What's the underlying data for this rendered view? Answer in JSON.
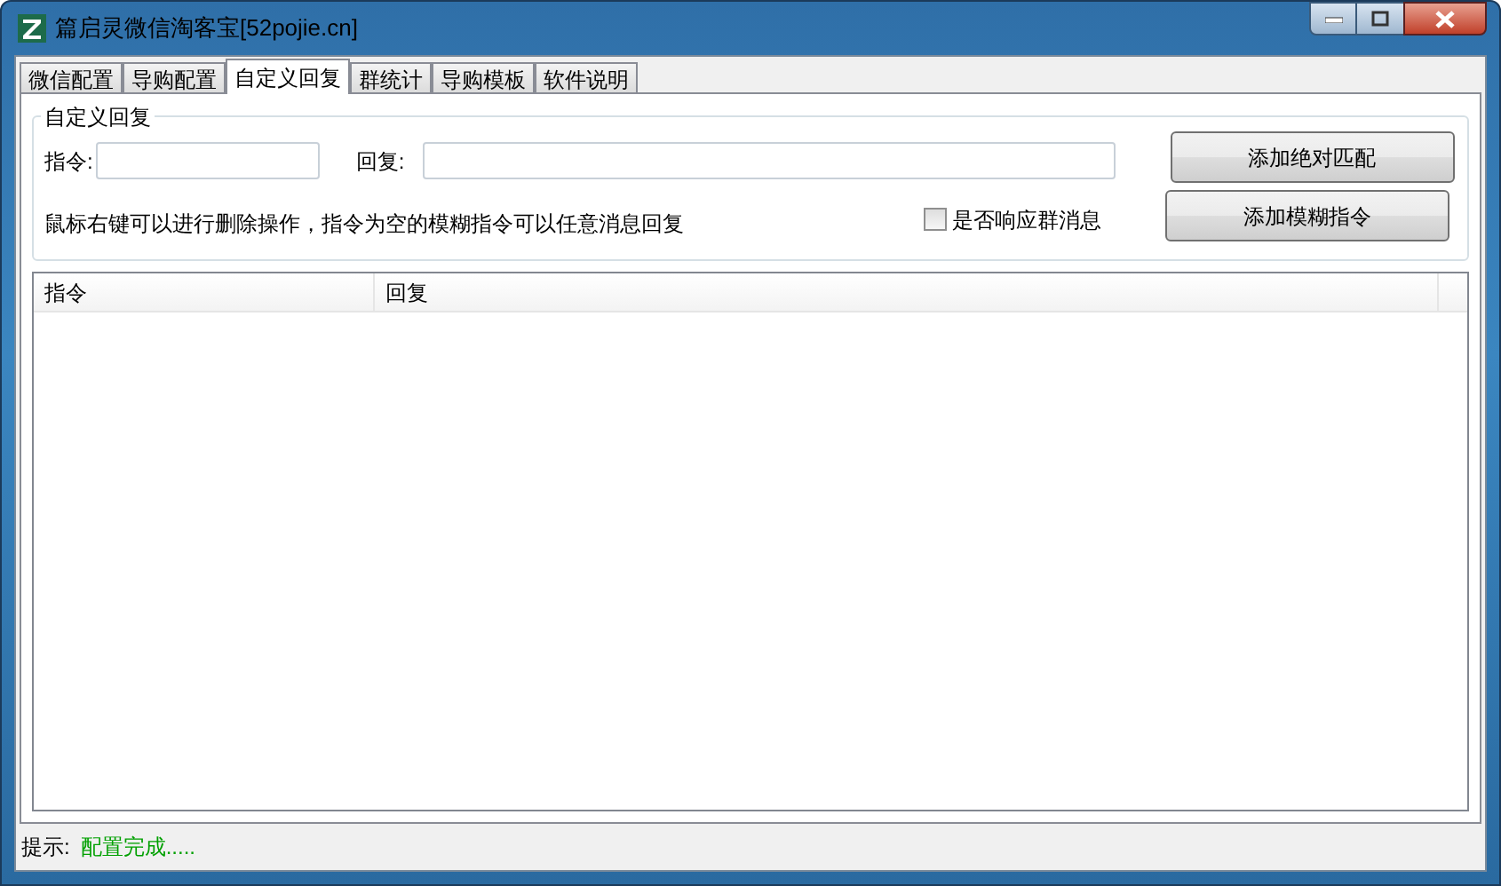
{
  "window": {
    "title": "篇启灵微信淘客宝[52pojie.cn]"
  },
  "tabs": [
    {
      "label": "微信配置",
      "selected": false
    },
    {
      "label": "导购配置",
      "selected": false
    },
    {
      "label": "自定义回复",
      "selected": true
    },
    {
      "label": "群统计",
      "selected": false
    },
    {
      "label": "导购模板",
      "selected": false
    },
    {
      "label": "软件说明",
      "selected": false
    }
  ],
  "group": {
    "title": "自定义回复",
    "command_label": "指令:",
    "reply_label": "回复:",
    "hint": "鼠标右键可以进行删除操作，指令为空的模糊指令可以任意消息回复",
    "checkbox": {
      "label": "是否响应群消息",
      "checked": false
    },
    "buttons": [
      "添加绝对匹配",
      "添加模糊指令"
    ]
  },
  "table": {
    "columns": [
      "指令",
      "回复"
    ]
  },
  "status_bar": {
    "label": "提示:",
    "message": "配置完成....."
  }
}
